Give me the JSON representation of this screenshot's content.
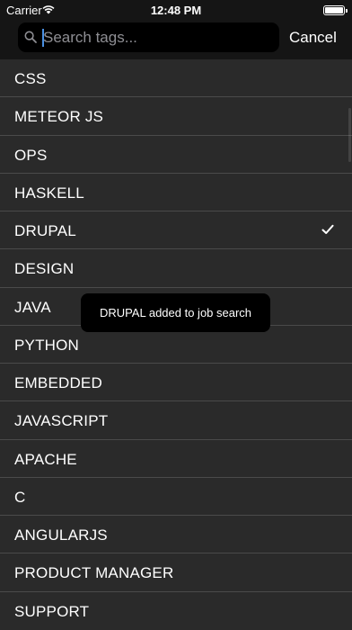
{
  "status_bar": {
    "carrier": "Carrier",
    "time": "12:48 PM"
  },
  "search": {
    "placeholder": "Search tags...",
    "value": "",
    "cancel_label": "Cancel"
  },
  "tags": [
    {
      "label": "CSS",
      "selected": false
    },
    {
      "label": "METEOR JS",
      "selected": false
    },
    {
      "label": "OPS",
      "selected": false
    },
    {
      "label": "HASKELL",
      "selected": false
    },
    {
      "label": "DRUPAL",
      "selected": true
    },
    {
      "label": "DESIGN",
      "selected": false
    },
    {
      "label": "JAVA",
      "selected": false
    },
    {
      "label": "PYTHON",
      "selected": false
    },
    {
      "label": "EMBEDDED",
      "selected": false
    },
    {
      "label": "JAVASCRIPT",
      "selected": false
    },
    {
      "label": "APACHE",
      "selected": false
    },
    {
      "label": "C",
      "selected": false
    },
    {
      "label": "ANGULARJS",
      "selected": false
    },
    {
      "label": "PRODUCT MANAGER",
      "selected": false
    },
    {
      "label": "SUPPORT",
      "selected": false
    }
  ],
  "toast": {
    "message": "DRUPAL added to job search"
  },
  "colors": {
    "background": "#2a2a2a",
    "header": "#151515",
    "separator": "#4a4a4a",
    "text": "#ffffff"
  },
  "icons": {
    "search": "search-icon",
    "check": "checkmark-icon",
    "wifi": "wifi-icon",
    "battery": "battery-icon"
  }
}
